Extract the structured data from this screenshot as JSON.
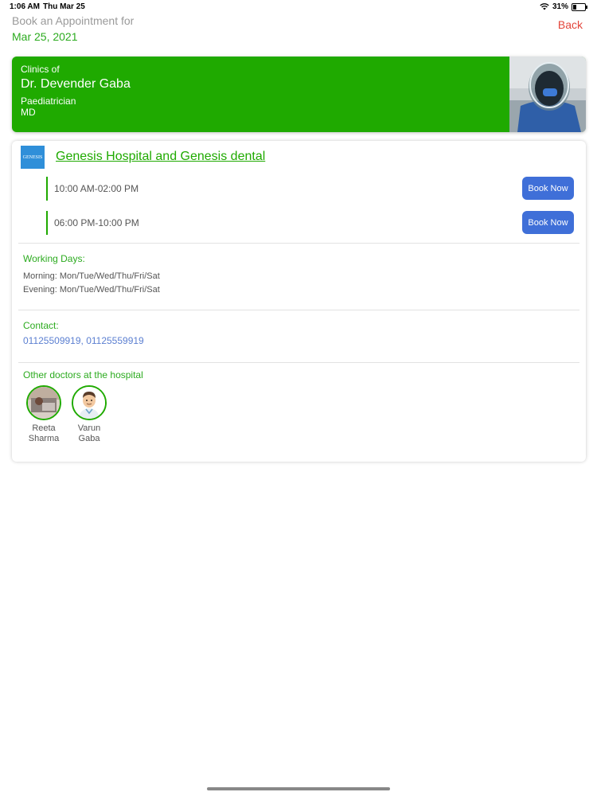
{
  "status_bar": {
    "time": "1:06 AM",
    "date": "Thu Mar 25",
    "battery": "31%",
    "battery_level": 0.31
  },
  "header": {
    "label": "Book an Appointment for",
    "date": "Mar 25, 2021",
    "back": "Back"
  },
  "doctor": {
    "clinics_of": "Clinics of",
    "name": "Dr. Devender Gaba",
    "specialty": "Paediatrician",
    "degree": "MD"
  },
  "clinic": {
    "logo_text": "GENESIS",
    "name": "Genesis Hospital and Genesis dental",
    "slots": [
      {
        "time": "10:00 AM-02:00 PM",
        "button": "Book Now"
      },
      {
        "time": "06:00 PM-10:00 PM",
        "button": "Book Now"
      }
    ],
    "working_days": {
      "title": "Working Days:",
      "morning": "Morning: Mon/Tue/Wed/Thu/Fri/Sat",
      "evening": "Evening: Mon/Tue/Wed/Thu/Fri/Sat"
    },
    "contact": {
      "title": "Contact:",
      "numbers": "01125509919, 01125559919"
    },
    "other_doctors": {
      "title": "Other doctors at the hospital",
      "doctors": [
        {
          "first": "Reeta",
          "last": "Sharma"
        },
        {
          "first": "Varun",
          "last": "Gaba"
        }
      ]
    }
  },
  "colors": {
    "green": "#1faa00",
    "button_blue": "#3f6fd8",
    "back_red": "#e3453b"
  }
}
